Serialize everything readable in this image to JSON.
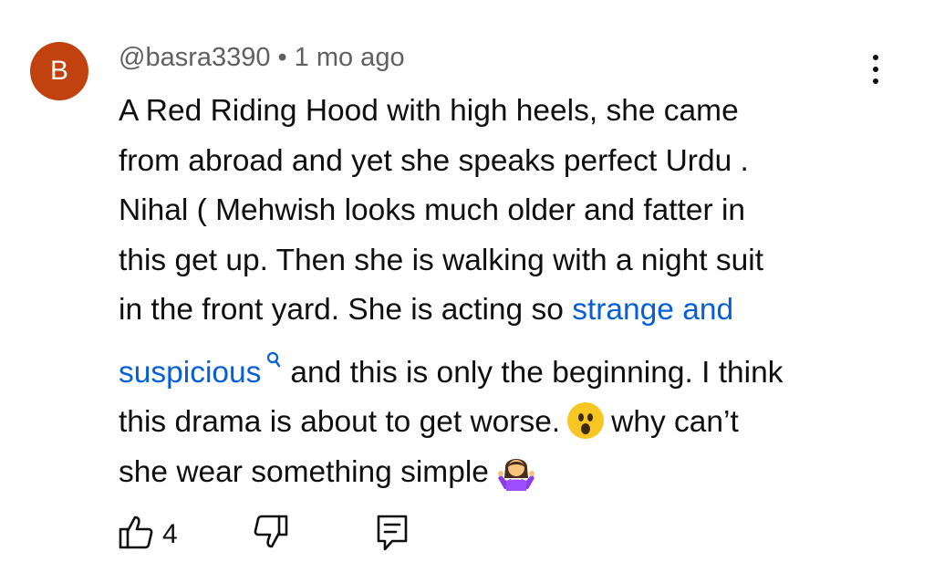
{
  "comment": {
    "avatar_letter": "B",
    "avatar_color": "#c1410f",
    "author": "@basra3390",
    "separator": "•",
    "time": "1 mo ago",
    "text_lines": [
      "A Red Riding Hood with high heels, she came",
      "from abroad and yet she speaks perfect Urdu .",
      "Nihal ( Mehwish looks much older and fatter in",
      "this get up. Then she is walking with a night suit"
    ],
    "line5_before": "in the front yard. She is acting so ",
    "link_text_1": "strange and",
    "link_text_2": "suspicious",
    "line6_after": "and this is only the beginning. I think",
    "line7_before": "this drama is about to get worse.",
    "line7_after": "why can’t",
    "line8": "she wear something simple",
    "emoji_1": "astonished-face-emoji",
    "emoji_2": "person-shrugging-emoji",
    "link_color": "#065fd4",
    "like_count": "4"
  },
  "icons": {
    "more": "vertical-ellipsis-icon",
    "search": "magnifier-icon",
    "like": "thumbs-up-icon",
    "dislike": "thumbs-down-icon",
    "reply": "reply-comment-icon"
  }
}
